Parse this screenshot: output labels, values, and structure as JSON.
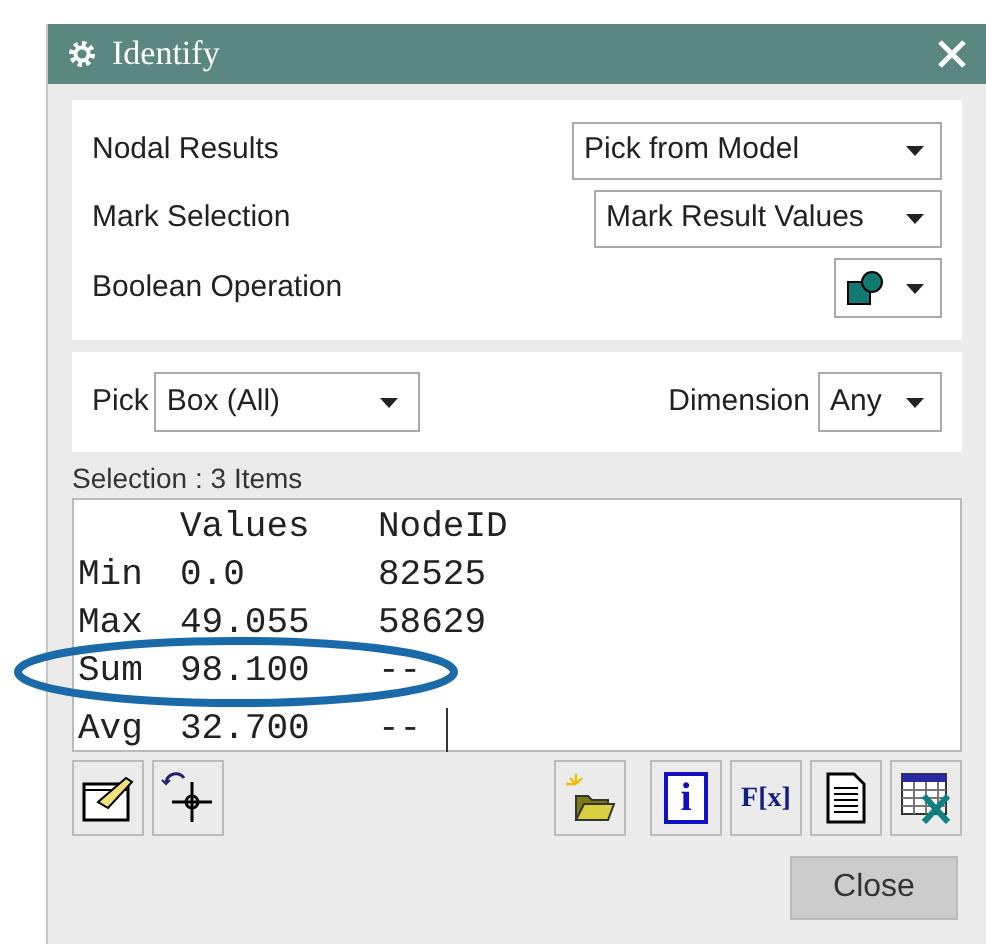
{
  "window": {
    "title": "Identify"
  },
  "options": [
    {
      "label": "Nodal Results",
      "kind": "text",
      "value": "Pick from Model"
    },
    {
      "label": "Mark Selection",
      "kind": "text",
      "value": "Mark Result Values"
    },
    {
      "label": "Boolean Operation",
      "kind": "icon"
    }
  ],
  "pick": {
    "label": "Pick",
    "value": "Box (All)"
  },
  "dimension": {
    "label": "Dimension",
    "value": "Any"
  },
  "selection_label": "Selection : 3 Items",
  "results": {
    "columns": [
      "Values",
      "NodeID"
    ],
    "rows": [
      {
        "label": "Min",
        "value": "0.0",
        "node": "82525"
      },
      {
        "label": "Max",
        "value": "49.055",
        "node": "58629"
      },
      {
        "label": "Sum",
        "value": "98.100",
        "node": "--"
      },
      {
        "label": "Avg",
        "value": "32.700",
        "node": "--"
      }
    ]
  },
  "toolbar_right": [
    {
      "kind": "folder"
    },
    {
      "kind": "info",
      "glyph": "i"
    },
    {
      "kind": "function",
      "glyph": "F[x]"
    },
    {
      "kind": "document"
    },
    {
      "kind": "spreadsheet"
    }
  ],
  "buttons": [
    "Close"
  ]
}
